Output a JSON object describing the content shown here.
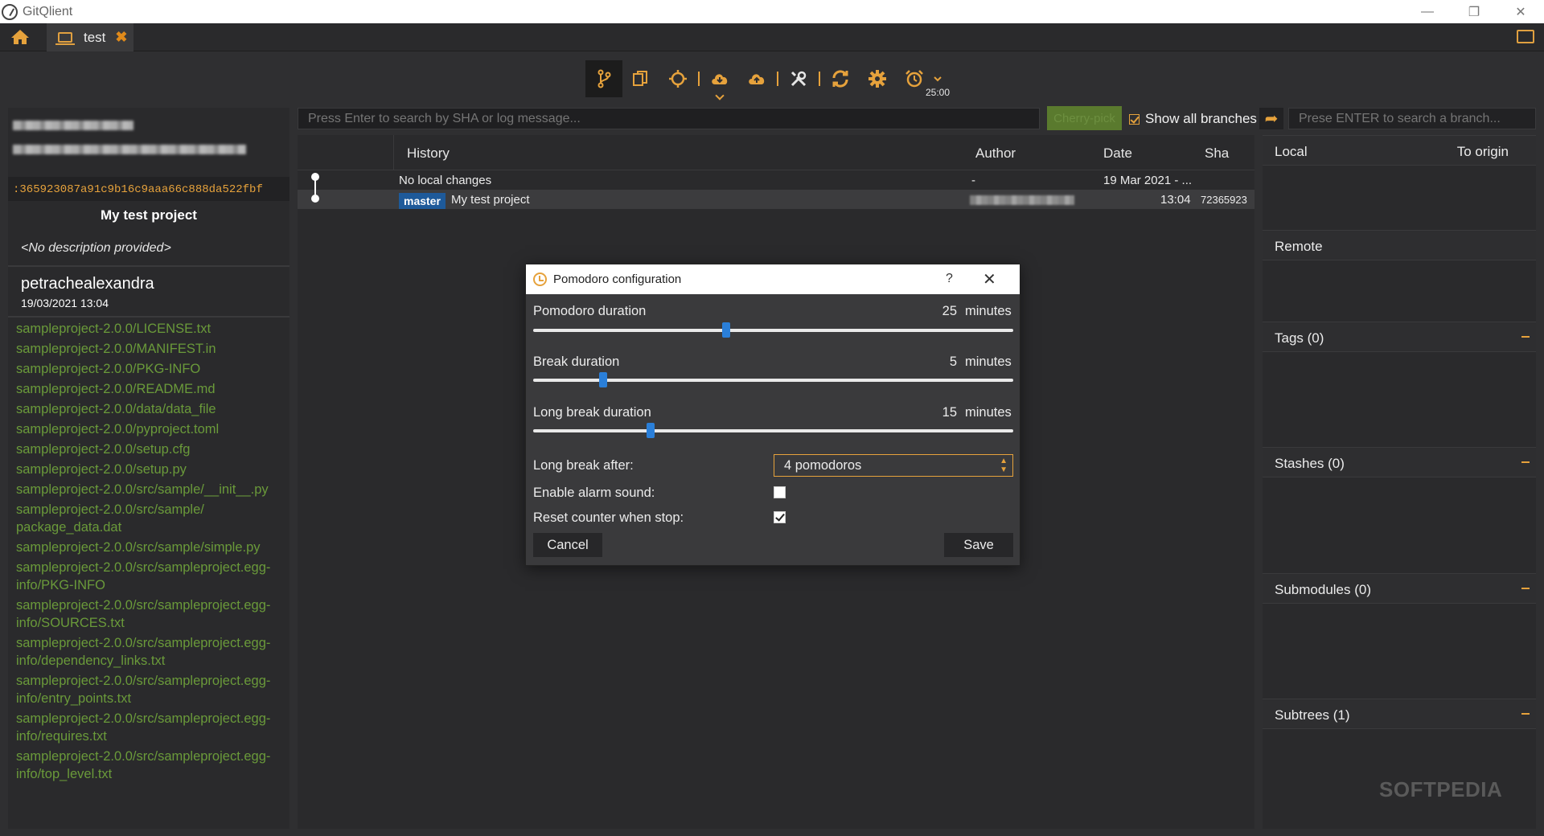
{
  "window": {
    "title": "GitQlient",
    "minimize": "—",
    "restore": "❐",
    "close": "✕"
  },
  "tabs": [
    {
      "label": "test",
      "close": "✖"
    }
  ],
  "toolbar": {
    "timer": "25:00"
  },
  "left": {
    "sha": ":365923087a91c9b16c9aaa66c888da522fbf",
    "project_name": "My test project",
    "description": "<No description provided>",
    "author": "petrachealexandra",
    "date": "19/03/2021 13:04",
    "files": [
      "sampleproject-2.0.0/LICENSE.txt",
      "sampleproject-2.0.0/MANIFEST.in",
      "sampleproject-2.0.0/PKG-INFO",
      "sampleproject-2.0.0/README.md",
      "sampleproject-2.0.0/data/data_file",
      "sampleproject-2.0.0/pyproject.toml",
      "sampleproject-2.0.0/setup.cfg",
      "sampleproject-2.0.0/setup.py",
      "sampleproject-2.0.0/src/sample/__init__.py",
      "sampleproject-2.0.0/src/sample/ package_data.dat",
      "sampleproject-2.0.0/src/sample/simple.py",
      "sampleproject-2.0.0/src/sampleproject.egg-info/PKG-INFO",
      "sampleproject-2.0.0/src/sampleproject.egg-info/SOURCES.txt",
      "sampleproject-2.0.0/src/sampleproject.egg-info/dependency_links.txt",
      "sampleproject-2.0.0/src/sampleproject.egg-info/entry_points.txt",
      "sampleproject-2.0.0/src/sampleproject.egg-info/requires.txt",
      "sampleproject-2.0.0/src/sampleproject.egg-info/top_level.txt"
    ]
  },
  "search": {
    "sha_placeholder": "Press Enter to search by SHA or log message...",
    "cherry_pick": "Cherry-pick",
    "show_all_branches": "Show all branches",
    "branch_placeholder": "Prese ENTER to search a branch..."
  },
  "history": {
    "columns": {
      "history": "History",
      "author": "Author",
      "date": "Date",
      "sha": "Sha"
    },
    "rows": [
      {
        "message": "No local changes",
        "author": "-",
        "date": "19 Mar 2021 - ...",
        "sha": ""
      },
      {
        "branch": "master",
        "message": "My test project",
        "author": "",
        "date": "13:04",
        "sha": "72365923"
      }
    ]
  },
  "branches": {
    "local": "Local",
    "to_origin": "To origin",
    "remote": "Remote",
    "tags": "Tags  (0)",
    "stashes": "Stashes  (0)",
    "submodules": "Submodules  (0)",
    "subtrees": "Subtrees  (1)"
  },
  "watermark": "SOFTPEDIA",
  "dialog": {
    "title": "Pomodoro configuration",
    "help": "?",
    "pomodoro_label": "Pomodoro duration",
    "pomodoro_value": "25",
    "break_label": "Break duration",
    "break_value": "5",
    "long_break_label": "Long break duration",
    "long_break_value": "15",
    "unit": "minutes",
    "sliders": {
      "pomodoro_fraction": 0.4,
      "break_fraction": 0.14,
      "long_break_fraction": 0.24
    },
    "long_break_after_label": "Long break after:",
    "long_break_after_value": "4 pomodoros",
    "alarm_label": "Enable alarm sound:",
    "alarm_checked": false,
    "reset_label": "Reset counter when stop:",
    "reset_checked": true,
    "cancel": "Cancel",
    "save": "Save"
  },
  "colors": {
    "accent": "#e6a23c",
    "file_green": "#6a9a3a",
    "branch_blue": "#1e5a9a",
    "slider_blue": "#2a7fd9"
  }
}
